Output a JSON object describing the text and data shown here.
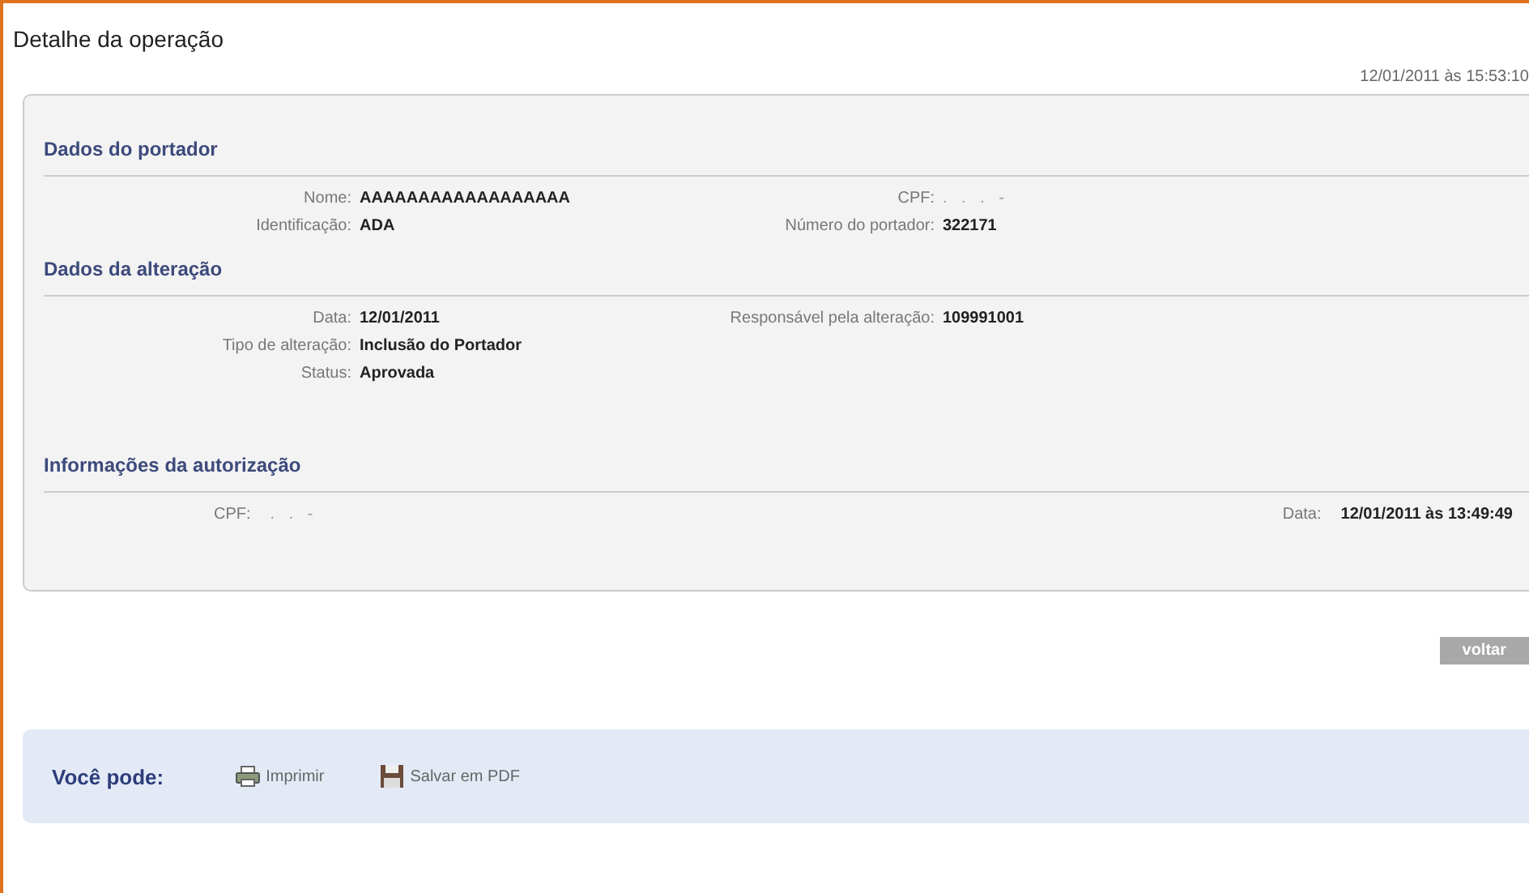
{
  "title": "Detalhe da operação",
  "timestamp": "12/01/2011 às 15:53:10",
  "sections": [
    {
      "heading": "Dados do portador",
      "kind": "grid",
      "rows": [
        {
          "left": {
            "label": "Nome:",
            "value": "AAAAAAAAAAAAAAAAAA"
          },
          "right": {
            "label": "CPF:",
            "value": ". . . -",
            "masked": true
          }
        },
        {
          "left": {
            "label": "Identificação:",
            "value": "ADA"
          },
          "right": {
            "label": "Número do portador:",
            "value": "322171"
          }
        }
      ]
    },
    {
      "heading": "Dados da alteração",
      "kind": "grid",
      "rows": [
        {
          "left": {
            "label": "Data:",
            "value": "12/01/2011"
          },
          "right": {
            "label": "Responsável pela alteração:",
            "value": "109991001"
          }
        },
        {
          "left": {
            "label": "Tipo de alteração:",
            "value": "Inclusão do Portador"
          }
        },
        {
          "left": {
            "label": "Status:",
            "value": "Aprovada"
          }
        }
      ]
    },
    {
      "heading": "Informações da autorização",
      "kind": "spread",
      "rows": [
        {
          "left": {
            "label": "CPF:",
            "value": ". . -",
            "masked": true
          },
          "right": {
            "label": "Data:",
            "value": "12/01/2011 às 13:49:49"
          }
        }
      ]
    }
  ],
  "back_button": "voltar",
  "actions": {
    "label": "Você pode:",
    "items": [
      {
        "kind": "print",
        "label": "Imprimir"
      },
      {
        "kind": "pdf",
        "label": "Salvar em PDF"
      }
    ]
  }
}
